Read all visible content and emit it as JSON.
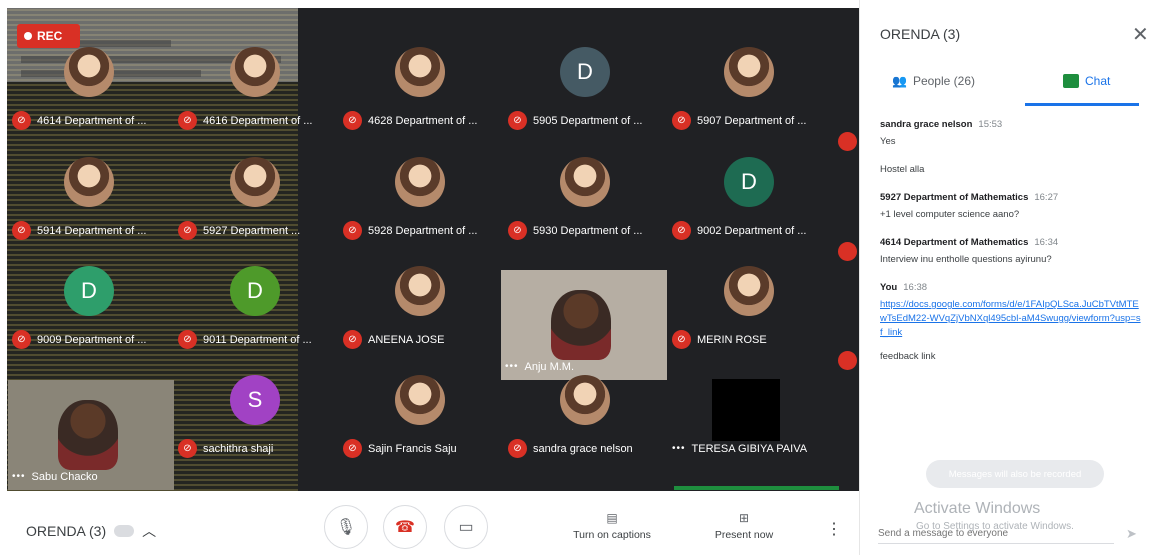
{
  "meeting": {
    "name": "ORENDA (3)",
    "rec_label": "REC"
  },
  "grid": {
    "tiles": [
      {
        "name": "4614 Department of ...",
        "avatar": "photo"
      },
      {
        "name": "4616 Department of ...",
        "avatar": "photo"
      },
      {
        "name": "4628 Department of ...",
        "avatar": "photo"
      },
      {
        "name": "5905 Department of ...",
        "avatar": "letter",
        "letter": "D",
        "color": "#455a64"
      },
      {
        "name": "5907 Department of ...",
        "avatar": "photo"
      },
      {
        "name": "5914 Department of ...",
        "avatar": "photo"
      },
      {
        "name": "5927 Department ...",
        "avatar": "photo"
      },
      {
        "name": "5928 Department of ...",
        "avatar": "photo"
      },
      {
        "name": "5930 Department of ...",
        "avatar": "photo"
      },
      {
        "name": "9002 Department of ...",
        "avatar": "letter",
        "letter": "D",
        "color": "#1e6b52"
      },
      {
        "name": "9009 Department of ...",
        "avatar": "letter",
        "letter": "D",
        "color": "#2e9e6b"
      },
      {
        "name": "9011 Department of ...",
        "avatar": "letter",
        "letter": "D",
        "color": "#4e9a2a"
      },
      {
        "name": "ANEENA JOSE",
        "avatar": "photo"
      },
      {
        "name": "Anju M.M.",
        "avatar": "video"
      },
      {
        "name": "MERIN ROSE",
        "avatar": "photo"
      },
      {
        "name": "Sabu Chacko",
        "avatar": "video"
      },
      {
        "name": "sachithra shaji",
        "avatar": "letter",
        "letter": "S",
        "color": "#a142c4"
      },
      {
        "name": "Sajin Francis Saju",
        "avatar": "photo"
      },
      {
        "name": "sandra grace nelson",
        "avatar": "photo"
      },
      {
        "name": "TERESA GIBIYA PAIVA",
        "avatar": "black"
      }
    ]
  },
  "panel": {
    "title": "ORENDA (3)",
    "tab_people": "People (26)",
    "tab_chat": "Chat",
    "messages": [
      {
        "sender": "sandra grace nelson",
        "time": "15:53",
        "lines": [
          "Yes",
          "",
          "Hostel alla"
        ]
      },
      {
        "sender": "5927 Department of Mathematics",
        "time": "16:27",
        "lines": [
          "+1 level computer science aano?"
        ]
      },
      {
        "sender": "4614 Department of Mathematics",
        "time": "16:34",
        "lines": [
          "Interview inu entholle questions ayirunu?"
        ]
      },
      {
        "sender": "You",
        "time": "16:38",
        "link": "https://docs.google.com/forms/d/e/1FAIpQLSca.JuCbTVtMTEwTsEdM22-WVqZjVbNXql495cbl-aM4Swugg/viewform?usp=sf_link",
        "lines": [
          "feedback link"
        ]
      }
    ],
    "notice": "Messages will also be recorded",
    "input_placeholder": "Send a message to everyone",
    "watermark_title": "Activate Windows",
    "watermark_sub": "Go to Settings to activate Windows."
  },
  "bottombar": {
    "captions_label": "Turn on captions",
    "present_label": "Present now"
  }
}
